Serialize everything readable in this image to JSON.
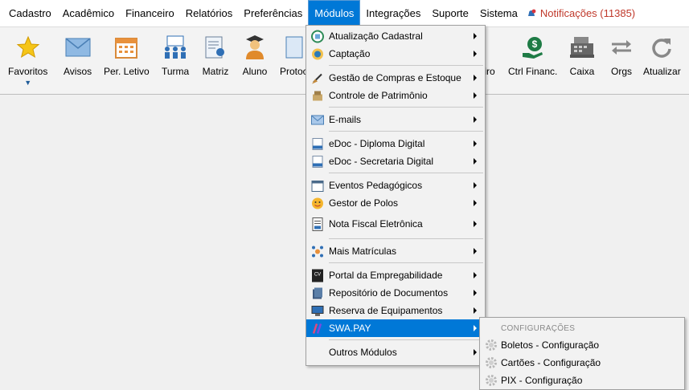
{
  "menubar": {
    "items": [
      "Cadastro",
      "Acadêmico",
      "Financeiro",
      "Relatórios",
      "Preferências",
      "Módulos",
      "Integrações",
      "Suporte",
      "Sistema"
    ],
    "notifications": "Notificações (11385)"
  },
  "toolbar": {
    "favorites": "Favoritos",
    "avisos": "Avisos",
    "per_letivo": "Per. Letivo",
    "turma": "Turma",
    "matriz": "Matriz",
    "aluno": "Aluno",
    "protocolo": "Protoc",
    "financeiro": "iro",
    "ctrl_financ": "Ctrl Financ.",
    "caixa": "Caixa",
    "orgs": "Orgs",
    "atualizar": "Atualizar"
  },
  "modulos_menu": {
    "items": [
      {
        "label": "Atualização Cadastral",
        "icon": "update-record-icon"
      },
      {
        "label": "Captação",
        "icon": "megaphone-icon"
      },
      {
        "label": "Gestão de Compras e Estoque",
        "icon": "broom-icon"
      },
      {
        "label": "Controle de Patrimônio",
        "icon": "box-icon"
      },
      {
        "label": "E-mails",
        "icon": "envelope-icon"
      },
      {
        "label": "eDoc - Diploma Digital",
        "icon": "document-icon"
      },
      {
        "label": "eDoc - Secretaria Digital",
        "icon": "document-icon"
      },
      {
        "label": "Eventos Pedagógicos",
        "icon": "calendar-icon"
      },
      {
        "label": "Gestor de Polos",
        "icon": "emoji-icon"
      },
      {
        "label": "Nota Fiscal Eletrônica",
        "icon": "invoice-icon"
      },
      {
        "label": "Mais Matrículas",
        "icon": "network-icon"
      },
      {
        "label": "Portal da Empregabilidade",
        "icon": "cv-icon"
      },
      {
        "label": "Repositório de Documentos",
        "icon": "folder-icon"
      },
      {
        "label": "Reserva de Equipamentos",
        "icon": "monitor-icon"
      },
      {
        "label": "SWA.PAY",
        "icon": "swapay-icon"
      },
      {
        "label": "Outros Módulos",
        "icon": ""
      }
    ]
  },
  "swapay_submenu": {
    "header": "CONFIGURAÇÕES",
    "items": [
      "Boletos - Configuração",
      "Cartões - Configuração",
      "PIX - Configuração"
    ]
  },
  "colors": {
    "menu_highlight": "#0078d7",
    "notification": "#c0392b"
  }
}
